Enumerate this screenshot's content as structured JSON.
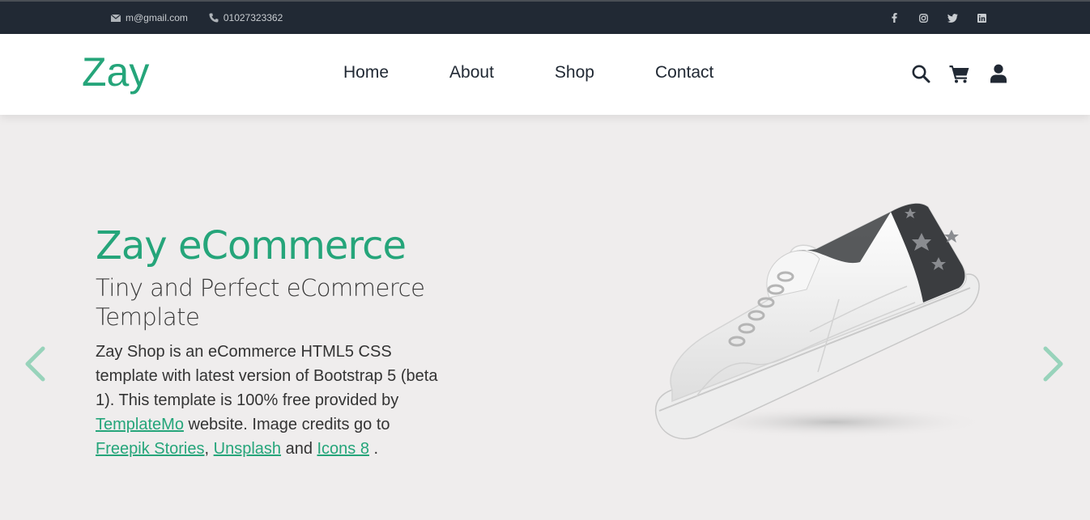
{
  "topbar": {
    "email": "m@gmail.com",
    "phone": "01027323362",
    "social": [
      "facebook-icon",
      "instagram-icon",
      "twitter-icon",
      "linkedin-icon"
    ]
  },
  "nav": {
    "logo": "Zay",
    "items": [
      "Home",
      "About",
      "Shop",
      "Contact"
    ],
    "icons": [
      "search-icon",
      "cart-icon",
      "user-icon"
    ]
  },
  "hero": {
    "title": "Zay eCommerce",
    "subtitle": "Tiny and Perfect eCommerce Template",
    "text_before": "Zay Shop is an eCommerce HTML5 CSS template with latest version of Bootstrap 5 (beta 1). This template is 100% free provided by ",
    "link_templatemo": "TemplateMo",
    "text_middle": " website. Image credits go to ",
    "link_freepik": "Freepik Stories",
    "comma": ", ",
    "link_unsplash": "Unsplash",
    "and": " and ",
    "link_icons8": "Icons 8",
    "end": " ."
  },
  "colors": {
    "brand": "#25a57a",
    "topbar": "#212934",
    "hero_bg": "#efeded"
  }
}
